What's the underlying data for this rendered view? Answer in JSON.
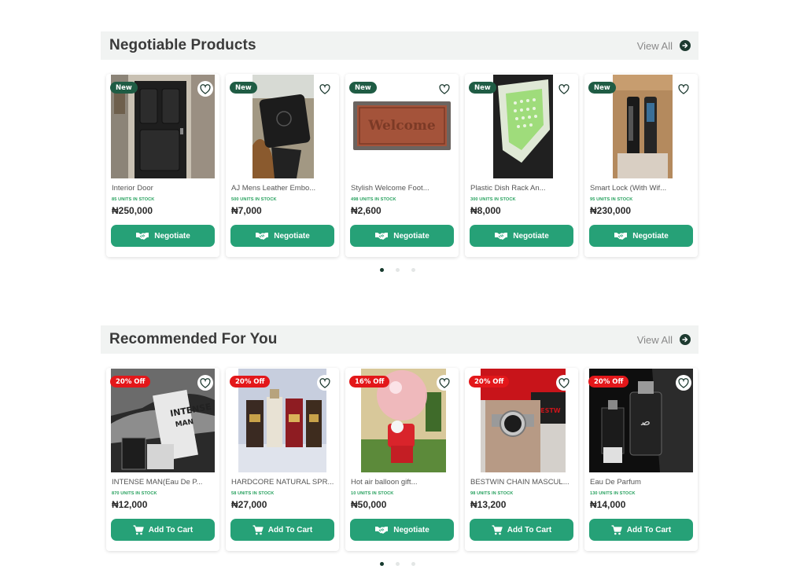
{
  "negotiable": {
    "title": "Negotiable Products",
    "view_all": "View All",
    "products": [
      {
        "badge": "New",
        "name": "Interior Door",
        "stock": "85 UNITS IN STOCK",
        "price": "₦250,000",
        "button": "Negotiate",
        "image": "black interior door"
      },
      {
        "badge": "New",
        "name": "AJ Mens Leather Embo...",
        "stock": "500 UNITS IN STOCK",
        "price": "₦7,000",
        "button": "Negotiate",
        "image": "black leather wallet in hand"
      },
      {
        "badge": "New",
        "name": "Stylish Welcome Foot...",
        "stock": "498 UNITS IN STOCK",
        "price": "₦2,600",
        "button": "Negotiate",
        "image": "brown welcome doormat"
      },
      {
        "badge": "New",
        "name": "Plastic Dish Rack An...",
        "stock": "300 UNITS IN STOCK",
        "price": "₦8,000",
        "button": "Negotiate",
        "image": "green plastic dish rack"
      },
      {
        "badge": "New",
        "name": "Smart Lock (With Wif...",
        "stock": "95 UNITS IN STOCK",
        "price": "₦230,000",
        "button": "Negotiate",
        "image": "smart door lock"
      }
    ]
  },
  "recommended": {
    "title": "Recommended For You",
    "view_all": "View All",
    "products": [
      {
        "badge": "20% Off",
        "name": "INTENSE MAN(Eau De P...",
        "stock": "870 UNITS IN STOCK",
        "price": "₦12,000",
        "button": "Add To Cart",
        "button_icon": "cart-icon",
        "image": "intense man perfume box"
      },
      {
        "badge": "20% Off",
        "name": "HARDCORE NATURAL SPR...",
        "stock": "58 UNITS IN STOCK",
        "price": "₦27,000",
        "button": "Add To Cart",
        "button_icon": "cart-icon",
        "image": "perfume bottles set"
      },
      {
        "badge": "16% Off",
        "name": "Hot air balloon gift...",
        "stock": "10 UNITS IN STOCK",
        "price": "₦50,000",
        "button": "Negotiate",
        "button_icon": "handshake-icon",
        "image": "pink balloon gift"
      },
      {
        "badge": "20% Off",
        "name": "BESTWIN CHAIN MASCUL...",
        "stock": "98 UNITS IN STOCK",
        "price": "₦13,200",
        "button": "Add To Cart",
        "button_icon": "cart-icon",
        "image": "silver wrist watch"
      },
      {
        "badge": "20% Off",
        "name": "Eau De Parfum",
        "stock": "130 UNITS IN STOCK",
        "price": "₦14,000",
        "button": "Add To Cart",
        "button_icon": "cart-icon",
        "image": "black perfume bottles"
      }
    ]
  },
  "colors": {
    "accent": "#26a177",
    "new_badge": "#1f5c44",
    "discount_badge": "#e3171a",
    "stock_text": "#27a15e",
    "dot_active": "#163a2d"
  }
}
